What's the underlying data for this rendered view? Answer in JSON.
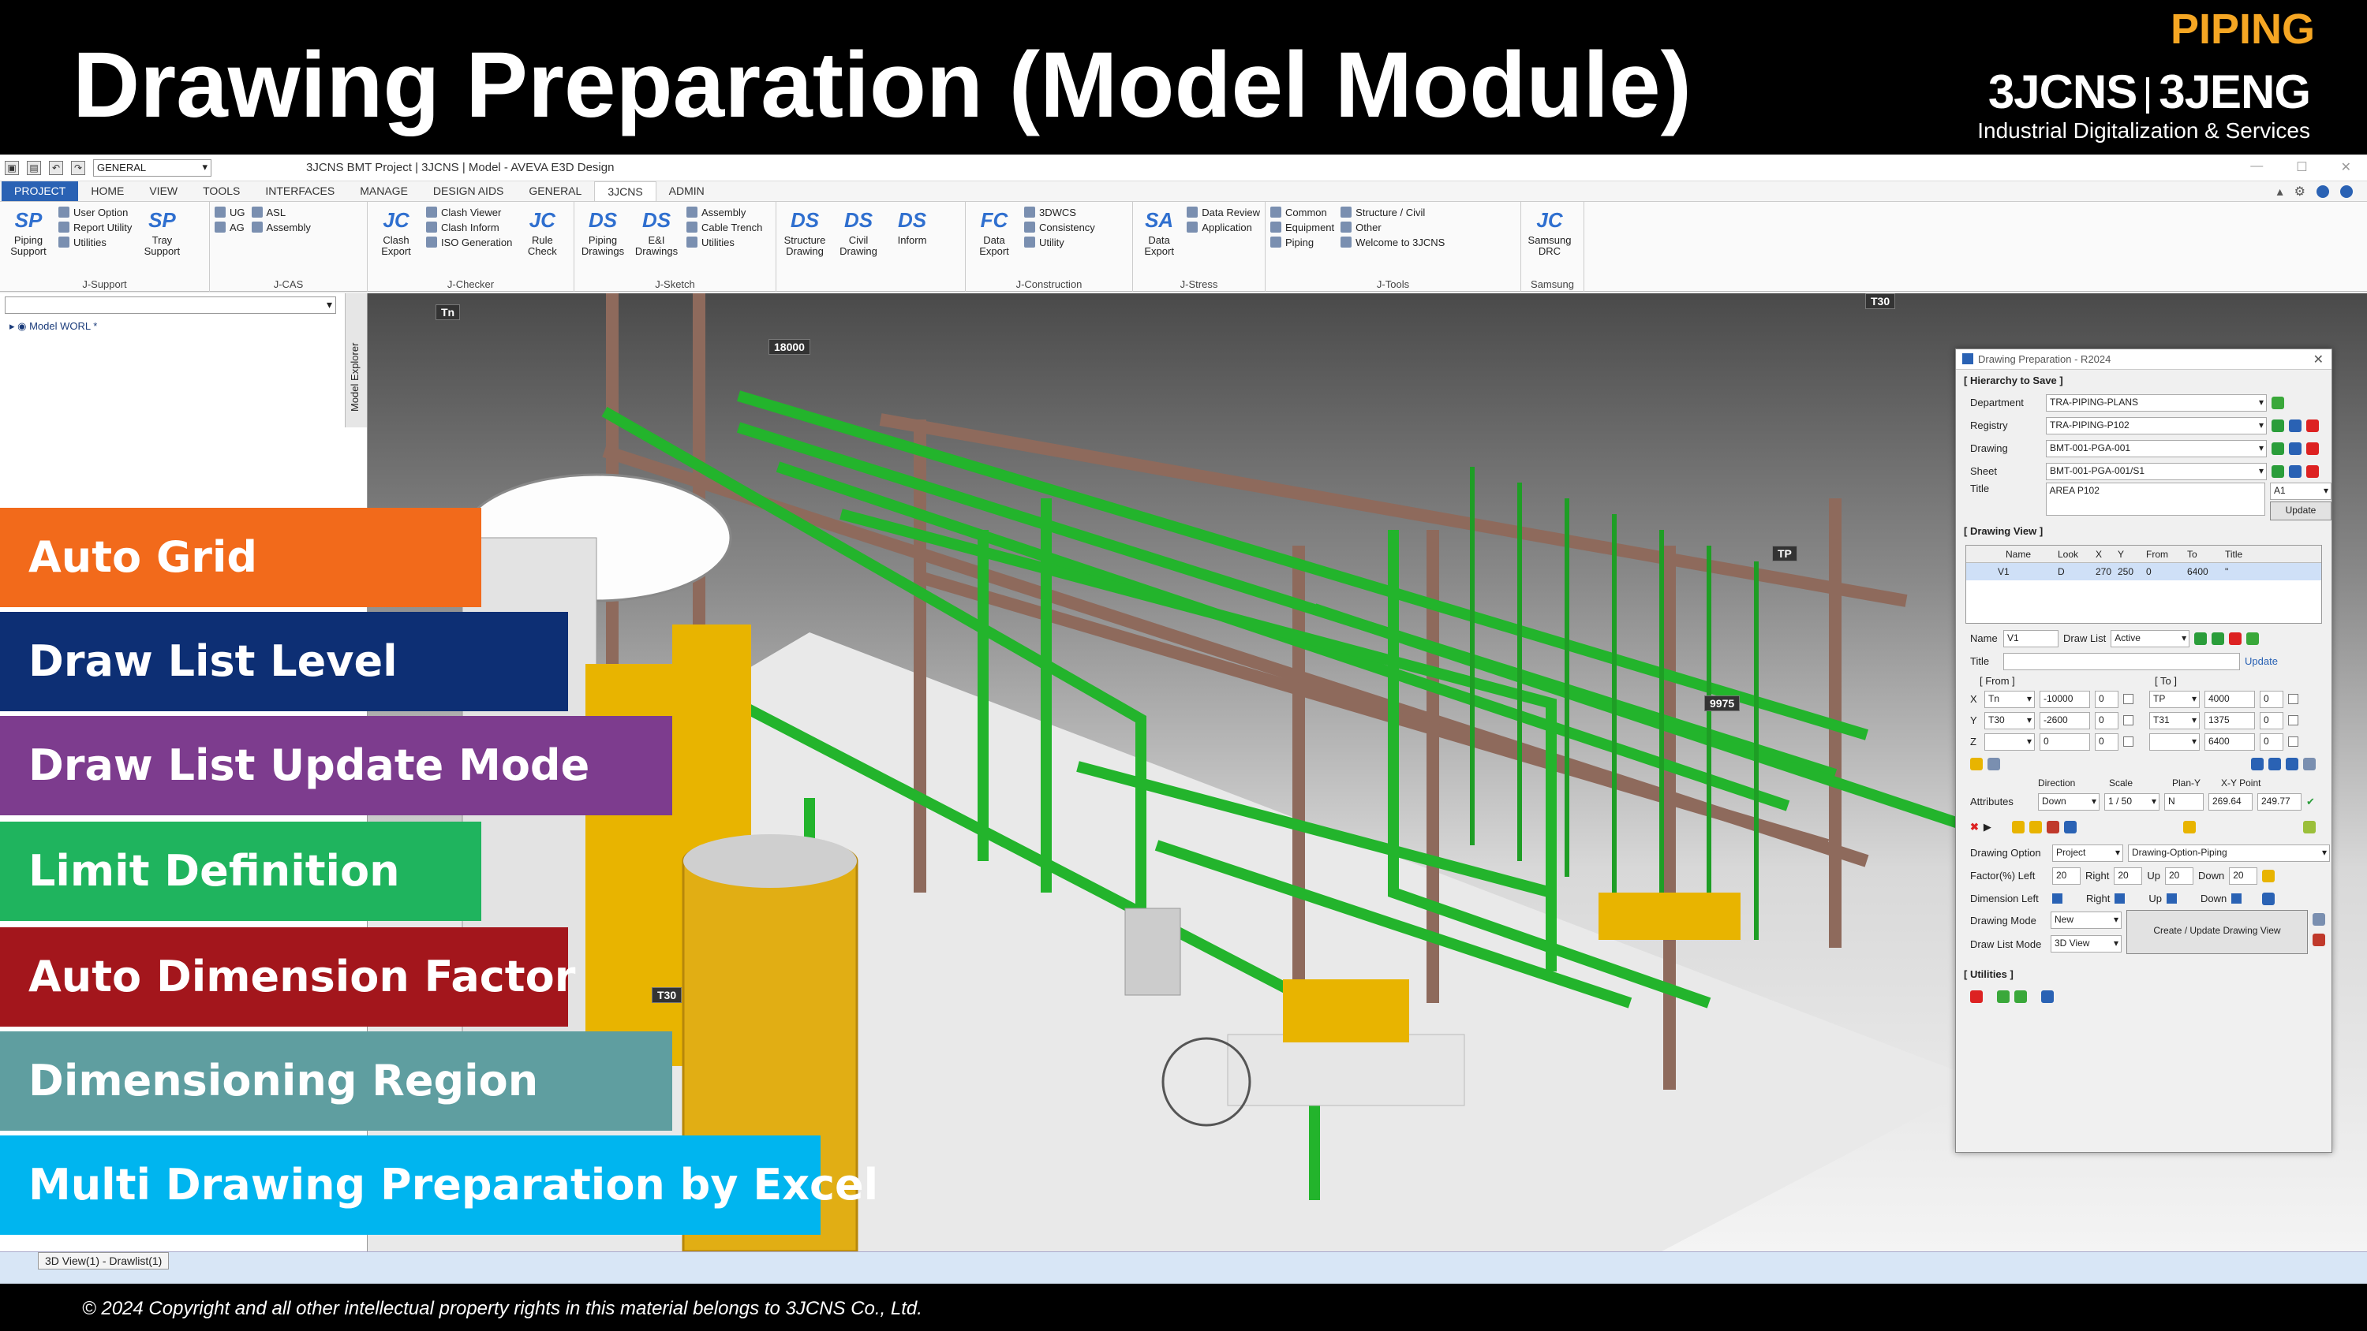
{
  "banner": {
    "title": "Drawing Preparation (Model Module)",
    "tag": "PIPING",
    "brand_left": "3JCNS",
    "brand_right": "3JENG",
    "subbrand": "Industrial Digitalization & Services"
  },
  "app": {
    "window_title": "3JCNS BMT Project | 3JCNS | Model - AVEVA E3D Design",
    "qat_combo": "GENERAL",
    "tabs": [
      "PROJECT",
      "HOME",
      "VIEW",
      "TOOLS",
      "INTERFACES",
      "MANAGE",
      "DESIGN AIDS",
      "GENERAL",
      "3JCNS",
      "ADMIN"
    ],
    "ribbon": {
      "jsupport": {
        "label": "J-Support",
        "btn1": "Piping Support",
        "btn2": "Tray Support",
        "items": [
          "User Option",
          "Report Utility",
          "Utilities"
        ]
      },
      "jcas": {
        "label": "J-CAS",
        "items": [
          "UG",
          "AG",
          "ASL",
          "Assembly"
        ]
      },
      "jchecker": {
        "label": "J-Checker",
        "btn1": "Clash Export",
        "btn2": "Rule Check",
        "items": [
          "Clash Viewer",
          "Clash Inform",
          "ISO Generation"
        ]
      },
      "jsketch": {
        "label": "J-Sketch",
        "btn1": "Piping Drawings",
        "btn2": "E&I Drawings",
        "items": [
          "Assembly",
          "Cable Trench",
          "Utilities"
        ]
      },
      "sk2": {
        "btn1": "Structure Drawing",
        "btn2": "Civil Drawing",
        "btn3": "Inform"
      },
      "jconstruction": {
        "label": "J-Construction",
        "btn1": "Data Export",
        "items": [
          "3DWCS",
          "Consistency",
          "Utility"
        ]
      },
      "jstress": {
        "label": "J-Stress",
        "btn1": "Data Export",
        "items": [
          "Data Review",
          "Application"
        ]
      },
      "jtools": {
        "label": "J-Tools",
        "items": [
          "Common",
          "Equipment",
          "Piping",
          "Structure / Civil",
          "Other",
          "Welcome to 3JCNS"
        ]
      },
      "samsung": {
        "label": "Samsung",
        "btn1": "Samsung DRC"
      }
    },
    "explorer": {
      "tree_item": "Model WORL *",
      "strip_label": "Model Explorer"
    },
    "view_tab": "3D View(1) - Drawlist(1)",
    "viewport_labels": {
      "tn": "Tn",
      "g18000": "18000",
      "t30a": "T30",
      "tp": "TP",
      "g9975": "9975",
      "t30b": "T30"
    }
  },
  "features": [
    {
      "label": "Auto Grid",
      "color": "#f26a1b"
    },
    {
      "label": "Draw List Level",
      "color": "#0d2f74"
    },
    {
      "label": "Draw List Update Mode",
      "color": "#7d3c8e"
    },
    {
      "label": "Limit Definition",
      "color": "#1fb45e"
    },
    {
      "label": "Auto Dimension Factor",
      "color": "#a3161c"
    },
    {
      "label": "Dimensioning Region",
      "color": "#5f9ea0"
    },
    {
      "label": "Multi Drawing Preparation by Excel",
      "color": "#00b5ef"
    }
  ],
  "panel": {
    "title": "Drawing Preparation - R2024",
    "hier_section": "[ Hierarchy to Save ]",
    "department_label": "Department",
    "department": "TRA-PIPING-PLANS",
    "registry_label": "Registry",
    "registry": "TRA-PIPING-P102",
    "drawing_label": "Drawing",
    "drawing": "BMT-001-PGA-001",
    "sheet_label": "Sheet",
    "sheet": "BMT-001-PGA-001/S1",
    "title_label": "Title",
    "title_value": "AREA P102",
    "size": "A1",
    "update_btn": "Update",
    "view_section": "[ Drawing View ]",
    "view_cols": [
      "Name",
      "Look",
      "X",
      "Y",
      "From",
      "To",
      "Title"
    ],
    "view_row": [
      "V1",
      "D",
      "270",
      "250",
      "0",
      "6400",
      "\""
    ],
    "name_label": "Name",
    "name_value": "V1",
    "drawlist_label": "Draw List",
    "drawlist_value": "Active",
    "vtitle_label": "Title",
    "vupdate": "Update",
    "from_label": "[ From ]",
    "to_label": "[ To ]",
    "x_label": "X",
    "y_label": "Y",
    "z_label": "Z",
    "from_x": [
      "Tn",
      "-10000",
      "0"
    ],
    "from_y": [
      "T30",
      "-2600",
      "0"
    ],
    "from_z": [
      "0",
      "0"
    ],
    "to_x": [
      "TP",
      "4000",
      "0"
    ],
    "to_y": [
      "T31",
      "1375",
      "0"
    ],
    "to_z": [
      "6400",
      "0"
    ],
    "direction_label": "Direction",
    "scale_label": "Scale",
    "plany_label": "Plan-Y",
    "xy_label": "X-Y Point",
    "attributes_label": "Attributes",
    "direction": "Down",
    "scale": "1 / 50",
    "plany": "N",
    "xy_x": "269.64",
    "xy_y": "249.77",
    "dopt_label": "Drawing Option",
    "dopt_value": "Project",
    "dopt_value2": "Drawing-Option-Piping",
    "factor_label": "Factor(%) Left",
    "factor_left": "20",
    "right_label": "Right",
    "factor_right": "20",
    "up_label": "Up",
    "factor_up": "20",
    "down_label": "Down",
    "factor_down": "20",
    "dimleft_label": "Dimension Left",
    "dright_label": "Right",
    "dup_label": "Up",
    "ddown_label": "Down",
    "dmode_label": "Drawing Mode",
    "dmode_value": "New",
    "dlmode_label": "Draw List Mode",
    "dlmode_value": "3D View",
    "create_btn": "Create / Update Drawing View",
    "util_section": "[ Utilities ]"
  },
  "copyright": "© 2024 Copyright and all other intellectual property rights in this material belongs to 3JCNS Co., Ltd."
}
